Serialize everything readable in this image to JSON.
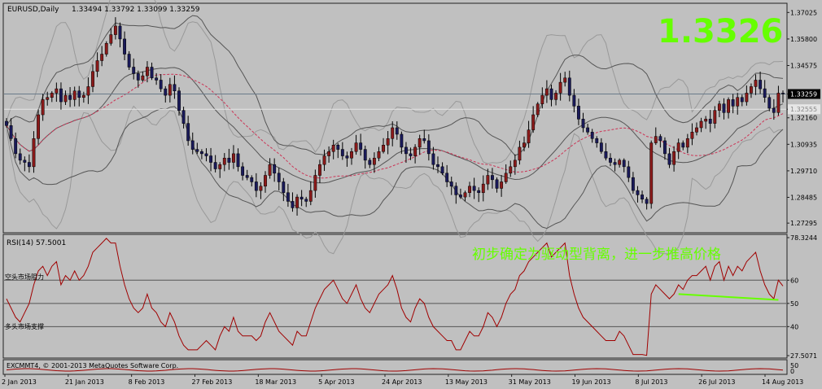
{
  "header": {
    "symbol_info": "EURUSD,Daily",
    "ohlc": "1.33494 1.33792 1.33099 1.33259",
    "big_price": "1.3326"
  },
  "colors": {
    "background": "#c0c0c0",
    "bull_candle": "#8b1a1a",
    "bear_candle": "#1a1a5a",
    "big_price": "#66ff00",
    "annotation": "#66ff00",
    "rsi_line": "#a00000",
    "ma_line": "#cc3355",
    "band_line": "#555555",
    "envelope_line": "#999999"
  },
  "chart_data": [
    {
      "type": "candlestick",
      "name": "main-price-chart",
      "title": "EURUSD,Daily",
      "y_ticks": [
        1.37025,
        1.358,
        1.34575,
        1.33259,
        1.32555,
        1.3216,
        1.30935,
        1.2971,
        1.28485,
        1.27295
      ],
      "y_tick_labels": [
        "1.37025",
        "1.35800",
        "1.34575",
        "1.33259",
        "1.32555",
        "1.32160",
        "1.30935",
        "1.29710",
        "1.28485",
        "1.27295"
      ],
      "current_price": 1.33259,
      "current_price_label": "1.33259",
      "secondary_price_label": "1.32555",
      "ylim": [
        1.27,
        1.373
      ],
      "grid": false,
      "closes": [
        1.318,
        1.312,
        1.305,
        1.302,
        1.301,
        1.299,
        1.312,
        1.323,
        1.33,
        1.331,
        1.333,
        1.335,
        1.329,
        1.332,
        1.33,
        1.334,
        1.331,
        1.332,
        1.336,
        1.343,
        1.348,
        1.351,
        1.356,
        1.36,
        1.364,
        1.358,
        1.351,
        1.345,
        1.342,
        1.339,
        1.341,
        1.345,
        1.34,
        1.339,
        1.335,
        1.332,
        1.337,
        1.334,
        1.325,
        1.319,
        1.311,
        1.307,
        1.306,
        1.305,
        1.304,
        1.301,
        1.298,
        1.3,
        1.303,
        1.301,
        1.305,
        1.299,
        1.295,
        1.294,
        1.292,
        1.288,
        1.29,
        1.295,
        1.3,
        1.296,
        1.292,
        1.287,
        1.283,
        1.28,
        1.285,
        1.284,
        1.283,
        1.288,
        1.295,
        1.3,
        1.304,
        1.306,
        1.309,
        1.307,
        1.304,
        1.303,
        1.306,
        1.31,
        1.307,
        1.302,
        1.3,
        1.303,
        1.306,
        1.309,
        1.312,
        1.317,
        1.314,
        1.308,
        1.305,
        1.304,
        1.308,
        1.312,
        1.311,
        1.305,
        1.3,
        1.299,
        1.296,
        1.292,
        1.29,
        1.286,
        1.285,
        1.287,
        1.29,
        1.288,
        1.287,
        1.291,
        1.295,
        1.293,
        1.289,
        1.292,
        1.296,
        1.299,
        1.302,
        1.308,
        1.31,
        1.316,
        1.323,
        1.328,
        1.332,
        1.335,
        1.33,
        1.333,
        1.338,
        1.34,
        1.332,
        1.327,
        1.321,
        1.317,
        1.315,
        1.312,
        1.31,
        1.306,
        1.303,
        1.301,
        1.3,
        1.302,
        1.299,
        1.294,
        1.288,
        1.286,
        1.284,
        1.282,
        1.31,
        1.313,
        1.311,
        1.305,
        1.3,
        1.306,
        1.31,
        1.308,
        1.312,
        1.315,
        1.317,
        1.32,
        1.321,
        1.319,
        1.325,
        1.328,
        1.324,
        1.33,
        1.327,
        1.331,
        1.329,
        1.333,
        1.336,
        1.339,
        1.335,
        1.331,
        1.326,
        1.324,
        1.333,
        1.3326
      ]
    },
    {
      "type": "line",
      "name": "rsi-chart",
      "title": "RSI(14) 57.5001",
      "y_ticks": [
        78.3244,
        60,
        50,
        40,
        27.5071
      ],
      "y_tick_labels": [
        "78.3244",
        "60",
        "50",
        "40",
        "27.5071"
      ],
      "levels": [
        60,
        50,
        40
      ],
      "ylim": [
        27.5071,
        78.3244
      ],
      "level_labels": [
        "空头市场阻力",
        "多头市场支撑"
      ],
      "series": [
        {
          "values": [
            52,
            48,
            44,
            42,
            46,
            50,
            58,
            64,
            66,
            62,
            66,
            68,
            58,
            62,
            60,
            64,
            60,
            62,
            66,
            72,
            74,
            76,
            78,
            76,
            76,
            66,
            58,
            52,
            48,
            46,
            48,
            54,
            48,
            46,
            42,
            40,
            46,
            42,
            36,
            32,
            30,
            30,
            30,
            32,
            34,
            32,
            30,
            36,
            40,
            38,
            44,
            38,
            36,
            36,
            36,
            34,
            36,
            42,
            46,
            42,
            38,
            36,
            34,
            32,
            38,
            36,
            36,
            42,
            48,
            52,
            56,
            58,
            60,
            56,
            52,
            50,
            54,
            58,
            52,
            48,
            46,
            50,
            54,
            56,
            58,
            62,
            56,
            48,
            44,
            42,
            48,
            52,
            50,
            44,
            40,
            38,
            36,
            34,
            34,
            30,
            30,
            34,
            38,
            36,
            36,
            40,
            46,
            44,
            40,
            44,
            50,
            54,
            56,
            62,
            64,
            68,
            70,
            72,
            74,
            76,
            70,
            72,
            74,
            76,
            62,
            54,
            48,
            44,
            42,
            40,
            38,
            36,
            34,
            34,
            34,
            38,
            36,
            32,
            28,
            28,
            28,
            27.6,
            54,
            58,
            56,
            54,
            52,
            54,
            58,
            56,
            60,
            62,
            62,
            64,
            66,
            60,
            66,
            68,
            60,
            66,
            62,
            66,
            64,
            68,
            70,
            72,
            64,
            58,
            54,
            52,
            60,
            57.5
          ]
        }
      ],
      "annotation": "初步确定为驱动型背离，进一步推高价格"
    },
    {
      "type": "line",
      "name": "bottom-indicator",
      "title": "EXCMMT4, © 2001-2013 MetaQuotes Software Corp.",
      "y_tick_labels": [
        "50",
        "0"
      ]
    }
  ],
  "x_axis": {
    "tick_labels": [
      "2 Jan 2013",
      "21 Jan 2013",
      "8 Feb 2013",
      "27 Feb 2013",
      "18 Mar 2013",
      "5 Apr 2013",
      "24 Apr 2013",
      "13 May 2013",
      "31 May 2013",
      "19 Jun 2013",
      "8 Jul 2013",
      "26 Jul 2013",
      "14 Aug 2013"
    ]
  }
}
